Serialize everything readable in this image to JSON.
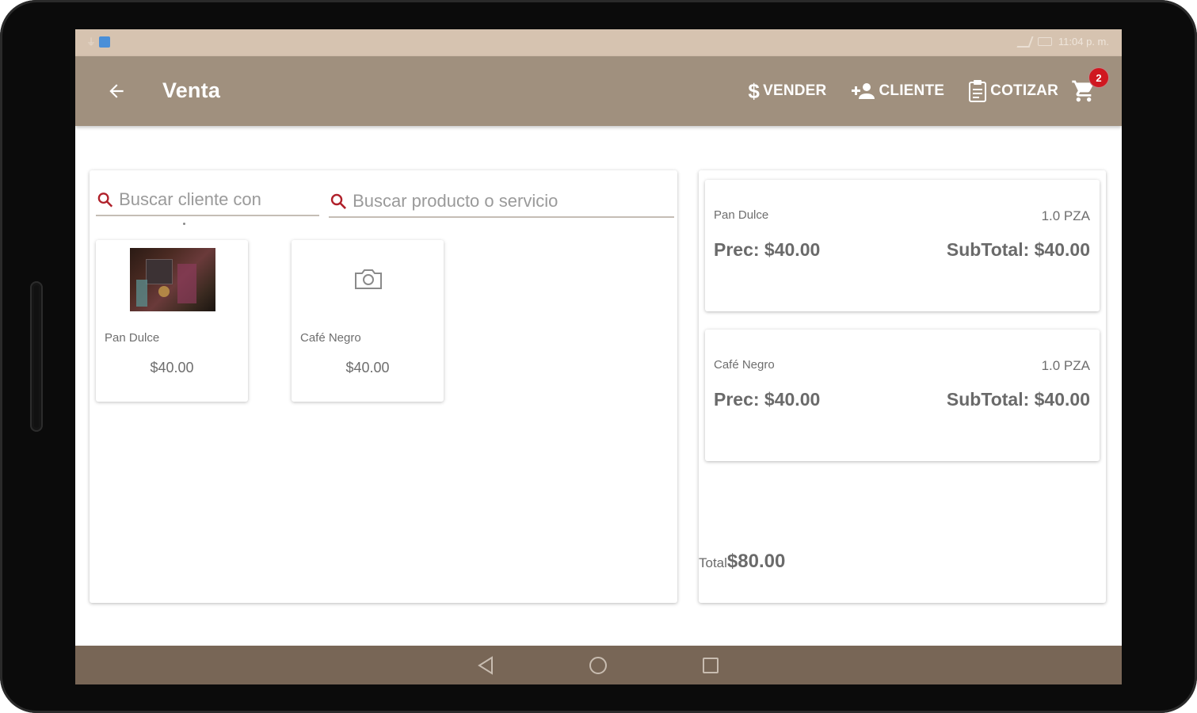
{
  "app": {
    "title": "Venta",
    "accent_color": "#a0907e",
    "nav_bar_color": "#786656",
    "status_bar_color": "#d6c3b0"
  },
  "status_bar": {
    "time": "11:04 p. m."
  },
  "toolbar": {
    "back_icon": "arrow-left-icon",
    "actions": [
      {
        "label": "VENDER",
        "icon": "dollar-icon"
      },
      {
        "label": "CLIENTE",
        "icon": "add-person-icon"
      },
      {
        "label": "COTIZAR",
        "icon": "clipboard-icon"
      }
    ],
    "cart_icon": "cart-icon",
    "cart_count": "2",
    "cart_badge_color": "#d01820"
  },
  "search": {
    "client_placeholder": "Buscar cliente con",
    "product_placeholder": "Buscar producto o servicio"
  },
  "products": [
    {
      "name": "Pan Dulce",
      "price": "$40.00",
      "image": "photo"
    },
    {
      "name": "Café Negro",
      "price": "$40.00",
      "image": "camera-icon"
    }
  ],
  "cart": {
    "items": [
      {
        "name": "Pan Dulce",
        "qty": "1.0 PZA",
        "price": "Prec: $40.00",
        "subtotal": "SubTotal: $40.00"
      },
      {
        "name": "Café Negro",
        "qty": "1.0 PZA",
        "price": "Prec: $40.00",
        "subtotal": "SubTotal: $40.00"
      }
    ],
    "total_label": "Total",
    "total_value": "$80.00"
  },
  "navigation": {
    "back": "nav-back-triangle-icon",
    "home": "nav-home-circle-icon",
    "recent": "nav-recent-square-icon"
  }
}
